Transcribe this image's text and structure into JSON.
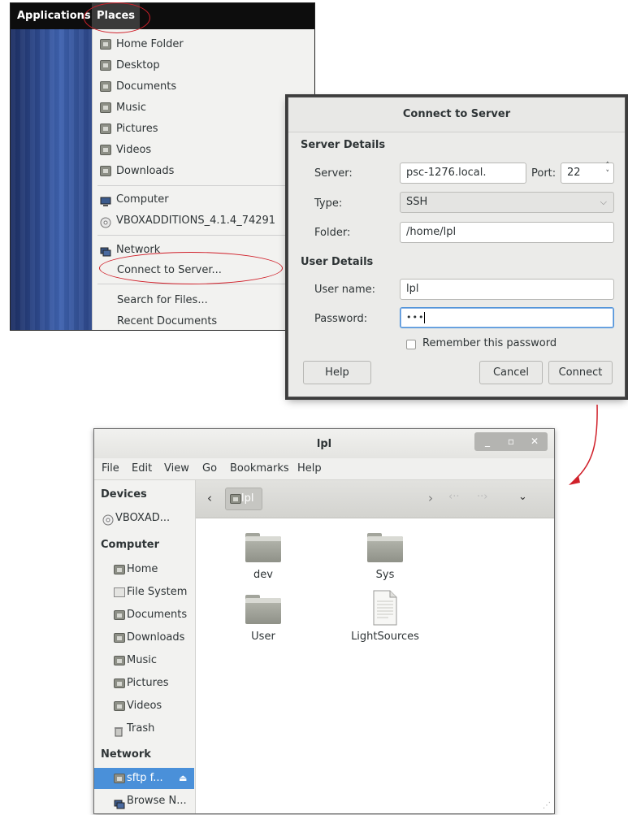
{
  "panel": {
    "applications_label": "Applications",
    "places_label": "Places"
  },
  "places_menu": {
    "items": [
      {
        "label": "Home Folder",
        "icon": "home-folder-icon"
      },
      {
        "label": "Desktop",
        "icon": "desktop-folder-icon"
      },
      {
        "label": "Documents",
        "icon": "documents-folder-icon"
      },
      {
        "label": "Music",
        "icon": "music-folder-icon"
      },
      {
        "label": "Pictures",
        "icon": "pictures-folder-icon"
      },
      {
        "label": "Videos",
        "icon": "videos-folder-icon"
      },
      {
        "label": "Downloads",
        "icon": "downloads-folder-icon"
      },
      {
        "label": "Computer",
        "icon": "computer-icon"
      },
      {
        "label": "VBOXADDITIONS_4.1.4_74291",
        "icon": "optical-disc-icon"
      },
      {
        "label": "Network",
        "icon": "network-icon"
      },
      {
        "label": "Connect to Server...",
        "icon": ""
      },
      {
        "label": "Search for Files...",
        "icon": ""
      },
      {
        "label": "Recent Documents",
        "icon": ""
      }
    ]
  },
  "connect_dialog": {
    "title": "Connect to Server",
    "server_details_header": "Server Details",
    "server_label": "Server:",
    "server_value": "psc-1276.local.",
    "port_label": "Port:",
    "port_value": "22",
    "type_label": "Type:",
    "type_value": "SSH",
    "folder_label": "Folder:",
    "folder_value": "/home/lpl",
    "user_details_header": "User Details",
    "username_label": "User name:",
    "username_value": "lpl",
    "password_label": "Password:",
    "password_value": "•••",
    "remember_label": "Remember this password",
    "remember_checked": false,
    "help_button": "Help",
    "cancel_button": "Cancel",
    "connect_button": "Connect"
  },
  "file_manager": {
    "title": "lpl",
    "menubar": [
      "File",
      "Edit",
      "View",
      "Go",
      "Bookmarks",
      "Help"
    ],
    "sidebar": {
      "devices_header": "Devices",
      "devices": [
        {
          "label": "VBOXAD...",
          "icon": "optical-disc-icon"
        }
      ],
      "computer_header": "Computer",
      "computer": [
        {
          "label": "Home",
          "icon": "home-folder-icon"
        },
        {
          "label": "File System",
          "icon": "filesystem-icon"
        },
        {
          "label": "Documents",
          "icon": "documents-folder-icon"
        },
        {
          "label": "Downloads",
          "icon": "downloads-folder-icon"
        },
        {
          "label": "Music",
          "icon": "music-folder-icon"
        },
        {
          "label": "Pictures",
          "icon": "pictures-folder-icon"
        },
        {
          "label": "Videos",
          "icon": "videos-folder-icon"
        },
        {
          "label": "Trash",
          "icon": "trash-icon"
        }
      ],
      "network_header": "Network",
      "network": [
        {
          "label": "sftp f...",
          "icon": "network-folder-icon",
          "selected": true
        },
        {
          "label": "Browse N...",
          "icon": "network-icon",
          "selected": false
        }
      ]
    },
    "path_label": "lpl",
    "items": [
      {
        "label": "dev",
        "type": "folder"
      },
      {
        "label": "Sys",
        "type": "folder"
      },
      {
        "label": "User",
        "type": "folder"
      },
      {
        "label": "LightSources",
        "type": "file"
      }
    ]
  },
  "colors": {
    "annotation_red": "#d0202a",
    "selection_blue": "#4a90d9"
  }
}
